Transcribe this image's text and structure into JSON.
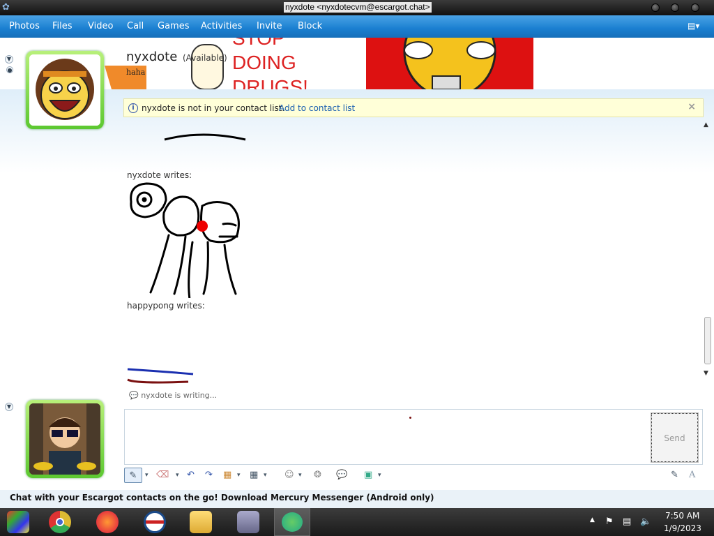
{
  "window": {
    "title": "nyxdote <nyxdotecvm@escargot.chat>"
  },
  "menu": {
    "items": [
      "Photos",
      "Files",
      "Video",
      "Call",
      "Games",
      "Activities",
      "Invite",
      "Block"
    ]
  },
  "contact": {
    "name": "nyxdote",
    "status": "(Available)",
    "personal_message": "haha",
    "banner_text": "STOP DOING DRUGS!"
  },
  "notice": {
    "text": "nyxdote is not in your contact list.",
    "link": "Add to contact list"
  },
  "conversation": {
    "messages": [
      {
        "author_line": "nyxdote writes:"
      },
      {
        "author_line": "happypong writes:"
      }
    ],
    "typing_indicator": "nyxdote is writing..."
  },
  "input": {
    "send_label": "Send"
  },
  "promo": {
    "text": "Chat with your Escargot contacts on the go! Download Mercury Messenger (Android only)"
  },
  "taskbar": {
    "time": "7:50 AM",
    "date": "1/9/2023"
  },
  "colors": {
    "menu_bar": "#1a7fd0",
    "avatar_frame": "#5cc830",
    "link": "#1a5fb0"
  }
}
